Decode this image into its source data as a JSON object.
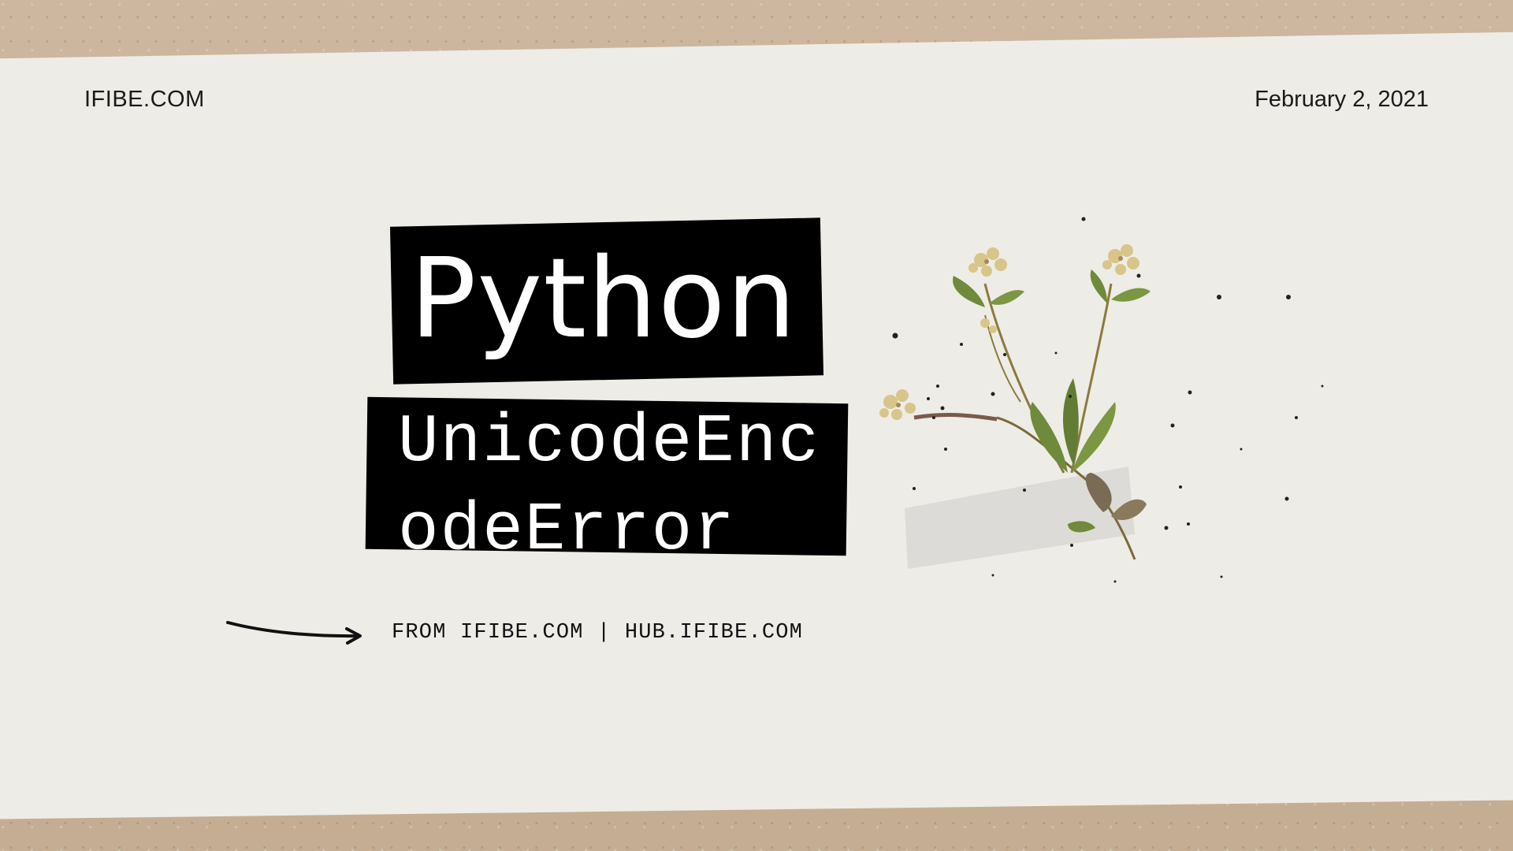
{
  "header": {
    "site": "IFIBE.COM",
    "date": "February 2, 2021"
  },
  "title": "Python",
  "subtitle": "UnicodeEncodeError",
  "source_line": "FROM IFIBE.COM | HUB.IFIBE.COM",
  "colors": {
    "background": "#c9b49b",
    "paper": "#eeece6",
    "label_bg": "#000000",
    "label_text": "#ffffff",
    "text": "#1a1a1a"
  },
  "decorations": {
    "pressed_flower": "flower-illustration",
    "arrow": "arrow-right-icon",
    "tape": "tape-strip"
  }
}
